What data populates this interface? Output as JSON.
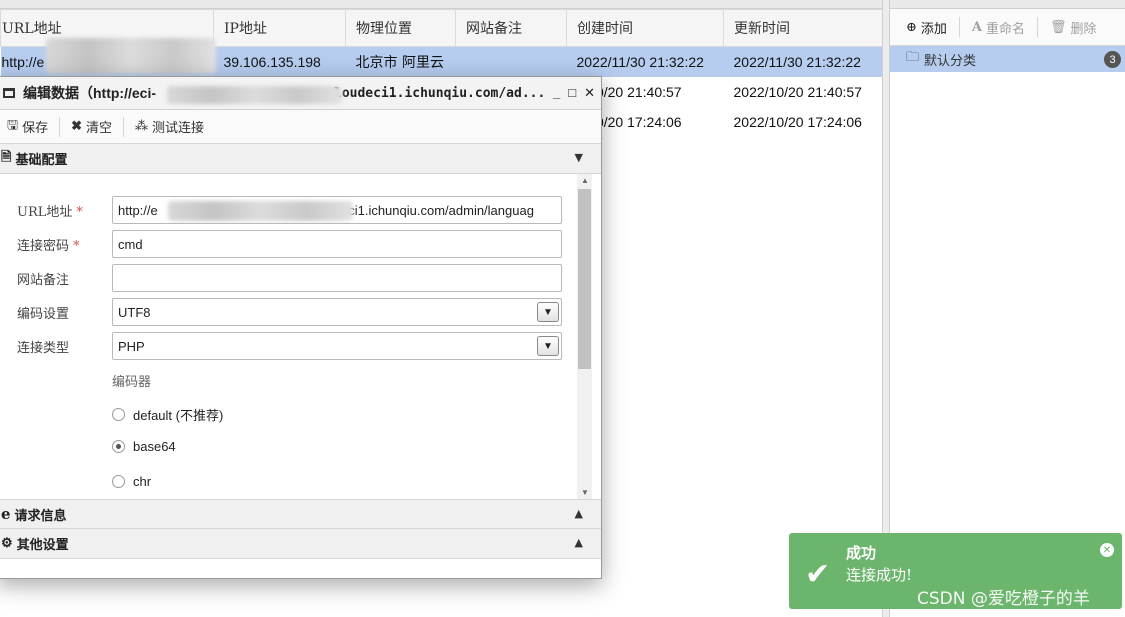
{
  "table": {
    "headers": [
      "URL地址",
      "IP地址",
      "物理位置",
      "网站备注",
      "创建时间",
      "更新时间"
    ],
    "rows": [
      {
        "url": "http://e",
        "ip": "39.106.135.198",
        "location": "北京市 阿里云",
        "note": "",
        "created": "2022/11/30 21:32:22",
        "updated": "2022/11/30 21:32:22"
      },
      {
        "url": "",
        "ip": "",
        "location": "",
        "note": "",
        "created": "2/10/20 21:40:57",
        "updated": "2022/10/20 21:40:57"
      },
      {
        "url": "",
        "ip": "",
        "location": "",
        "note": "",
        "created": "2/10/20 17:24:06",
        "updated": "2022/10/20 17:24:06"
      }
    ]
  },
  "category_panel": {
    "toolbar": {
      "add": "添加",
      "rename": "重命名",
      "delete": "删除"
    },
    "items": [
      {
        "label": "默认分类",
        "count": "3"
      }
    ]
  },
  "dialog": {
    "title_prefix": "编辑数据（http://eci-",
    "title_suffix": "loudeci1.ichunqiu.com/ad...",
    "window_buttons": {
      "minimize": "_",
      "maximize": "□",
      "close": "✕"
    },
    "toolbar": {
      "save": "保存",
      "clear": "清空",
      "test": "测试连接"
    },
    "sections": {
      "basic": "基础配置",
      "request": "请求信息",
      "other": "其他设置"
    },
    "form": {
      "url_label": "URL地址",
      "url_prefix": "http://e",
      "url_suffix": "deci1.ichunqiu.com/admin/languag",
      "password_label": "连接密码",
      "password_value": "cmd",
      "note_label": "网站备注",
      "note_value": "",
      "encoding_label": "编码设置",
      "encoding_value": "UTF8",
      "type_label": "连接类型",
      "type_value": "PHP",
      "encoder_label": "编码器",
      "encoders": [
        {
          "label": "default (不推荐)",
          "selected": false
        },
        {
          "label": "base64",
          "selected": true
        },
        {
          "label": "chr",
          "selected": false
        }
      ]
    }
  },
  "toast": {
    "title": "成功",
    "message": "连接成功!",
    "color": "#6cb56c"
  },
  "watermark": "CSDN @爱吃橙子的羊"
}
